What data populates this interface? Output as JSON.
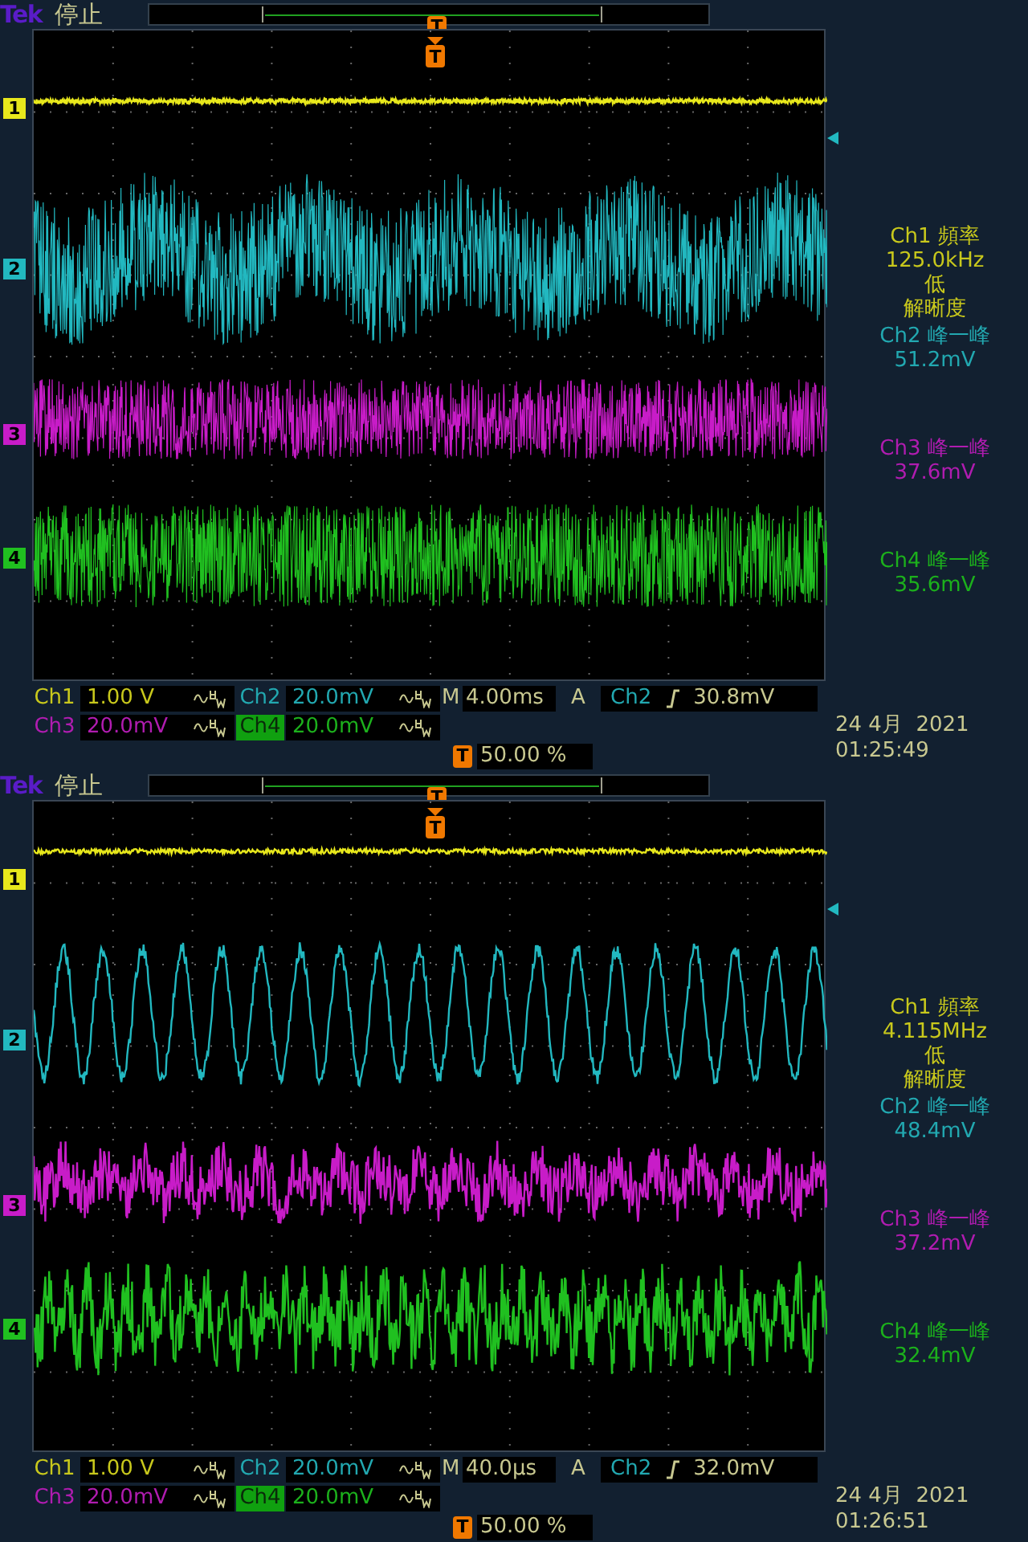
{
  "screens": [
    {
      "brand": "Tek",
      "status": "停止",
      "record_marker": "T",
      "trigger_marker": "T",
      "kind": "envelope",
      "channel_markers": [
        {
          "label": "1",
          "color": "#e8e81c"
        },
        {
          "label": "2",
          "color": "#22b8c0"
        },
        {
          "label": "3",
          "color": "#c81cc8"
        },
        {
          "label": "4",
          "color": "#20c020"
        }
      ],
      "readouts": [
        {
          "lines": [
            "Ch1 頻率",
            "125.0kHz",
            "低",
            "解晰度"
          ],
          "color": "#c8c81c"
        },
        {
          "lines": [
            "Ch2 峰一峰",
            "51.2mV"
          ],
          "color": "#22a8b0"
        },
        {
          "lines": [
            "Ch3 峰一峰",
            "37.6mV"
          ],
          "color": "#b01cb0"
        },
        {
          "lines": [
            "Ch4 峰一峰",
            "35.6mV"
          ],
          "color": "#1cb01c"
        }
      ],
      "channels": [
        {
          "label": "Ch1",
          "value": "1.00 V",
          "selected": false
        },
        {
          "label": "Ch2",
          "value": "20.0mV",
          "selected": false
        },
        {
          "label": "Ch3",
          "value": "20.0mV",
          "selected": false
        },
        {
          "label": "Ch4",
          "value": "20.0mV",
          "selected": true
        }
      ],
      "timebase": {
        "label": "M",
        "value": "4.00ms"
      },
      "trigger": {
        "label": "A",
        "source": "Ch2",
        "level": "30.8mV"
      },
      "trigger_position": {
        "marker": "T",
        "value": "50.00 %"
      },
      "date": "24 4月  2021",
      "time": "01:25:49"
    },
    {
      "brand": "Tek",
      "status": "停止",
      "record_marker": "T",
      "trigger_marker": "T",
      "kind": "trace",
      "channel_markers": [
        {
          "label": "1",
          "color": "#e8e81c"
        },
        {
          "label": "2",
          "color": "#22b8c0"
        },
        {
          "label": "3",
          "color": "#c81cc8"
        },
        {
          "label": "4",
          "color": "#20c020"
        }
      ],
      "readouts": [
        {
          "lines": [
            "Ch1 頻率",
            "4.115MHz",
            "低",
            "解晰度"
          ],
          "color": "#c8c81c"
        },
        {
          "lines": [
            "Ch2 峰一峰",
            "48.4mV"
          ],
          "color": "#22a8b0"
        },
        {
          "lines": [
            "Ch3 峰一峰",
            "37.2mV"
          ],
          "color": "#b01cb0"
        },
        {
          "lines": [
            "Ch4 峰一峰",
            "32.4mV"
          ],
          "color": "#1cb01c"
        }
      ],
      "channels": [
        {
          "label": "Ch1",
          "value": "1.00 V",
          "selected": false
        },
        {
          "label": "Ch2",
          "value": "20.0mV",
          "selected": false
        },
        {
          "label": "Ch3",
          "value": "20.0mV",
          "selected": false
        },
        {
          "label": "Ch4",
          "value": "20.0mV",
          "selected": true
        }
      ],
      "timebase": {
        "label": "M",
        "value": "40.0µs"
      },
      "trigger": {
        "label": "A",
        "source": "Ch2",
        "level": "32.0mV"
      },
      "trigger_position": {
        "marker": "T",
        "value": "50.00 %"
      },
      "date": "24 4月  2021",
      "time": "01:26:51"
    }
  ]
}
